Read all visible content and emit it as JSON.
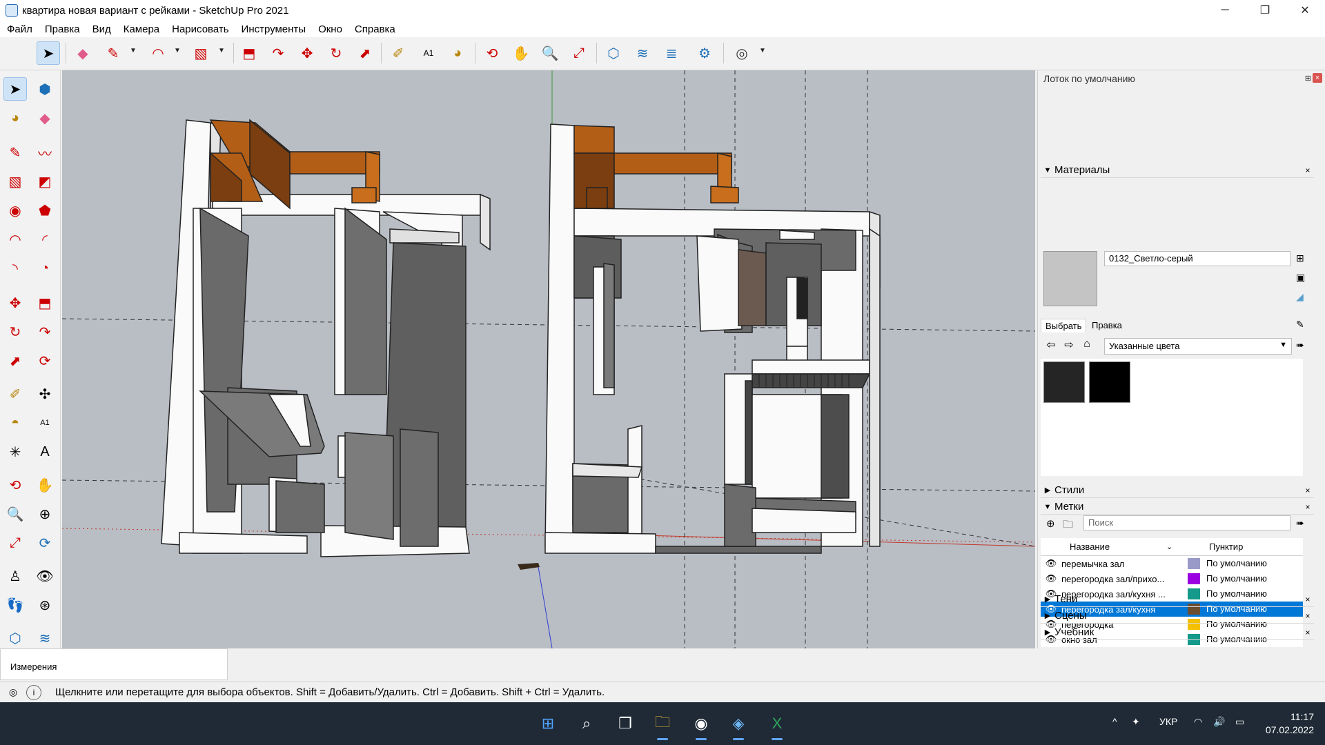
{
  "window": {
    "title": "квартира новая вариант с рейками - SketchUp Pro 2021",
    "minimize": "─",
    "maximize": "❐",
    "close": "✕"
  },
  "menu": [
    "Файл",
    "Правка",
    "Вид",
    "Камера",
    "Нарисовать",
    "Инструменты",
    "Окно",
    "Справка"
  ],
  "tray": {
    "title": "Лоток по умолчанию",
    "pin": "⊞",
    "close": "×"
  },
  "materials": {
    "header": "Материалы",
    "current_name": "0132_Светло-серый",
    "tab_select": "Выбрать",
    "tab_edit": "Правка",
    "collection": "Указанные цвета",
    "swatches": [
      "#252525",
      "#000000"
    ]
  },
  "styles": {
    "header": "Стили"
  },
  "tags": {
    "header": "Метки",
    "search_placeholder": "Поиск",
    "col_name": "Название",
    "col_dash": "Пунктир",
    "rows": [
      {
        "name": "перемычка зал",
        "color": "#9a9ac8",
        "dash": "По умолчанию",
        "selected": false
      },
      {
        "name": "перегородка зал/прихо...",
        "color": "#9b00e0",
        "dash": "По умолчанию",
        "selected": false
      },
      {
        "name": "перегородка зал/кухня ...",
        "color": "#14998a",
        "dash": "По умолчанию",
        "selected": false
      },
      {
        "name": "перегородка зал/кухня",
        "color": "#6b4d2f",
        "dash": "По умолчанию",
        "selected": true
      },
      {
        "name": "перегородка",
        "color": "#f5c000",
        "dash": "По умолчанию",
        "selected": false
      },
      {
        "name": "окно зал",
        "color": "#14998a",
        "dash": "По умолчанию",
        "selected": false
      }
    ]
  },
  "panels_bottom": [
    "Тени",
    "Сцены",
    "Учебник"
  ],
  "measurements_label": "Измерения",
  "status_message": "Щелкните или перетащите для выбора объектов. Shift = Добавить/Удалить. Ctrl = Добавить. Shift + Ctrl = Удалить.",
  "taskbar": {
    "lang": "УКР",
    "time": "11:17",
    "date": "07.02.2022"
  }
}
